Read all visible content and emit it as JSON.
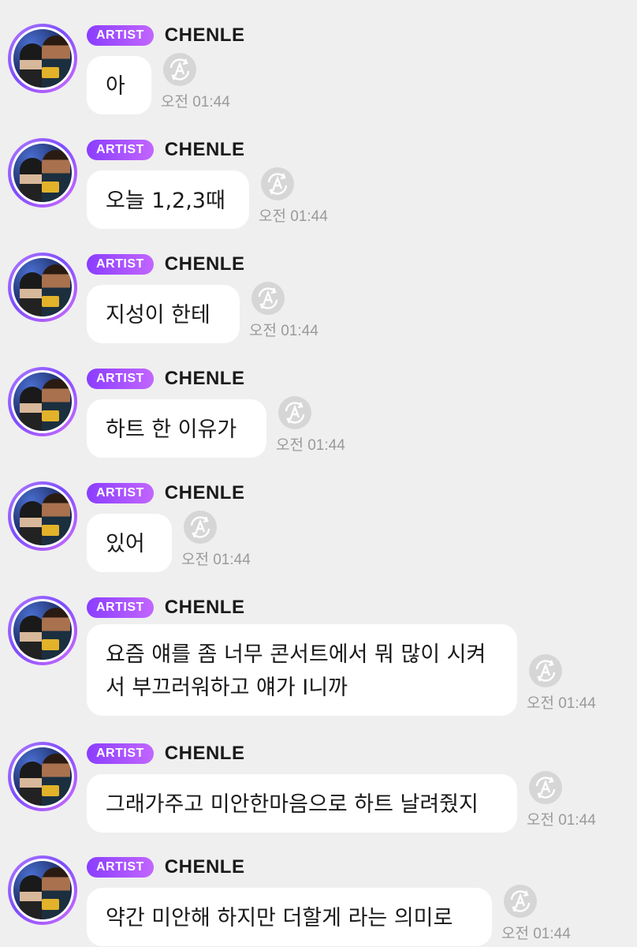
{
  "artist_badge": "ARTIST",
  "artist_name": "CHENLE",
  "messages": [
    {
      "text": "아",
      "time": "오전 01:44"
    },
    {
      "text": "오늘 1,2,3때",
      "time": "오전 01:44"
    },
    {
      "text": "지성이 한테",
      "time": "오전 01:44"
    },
    {
      "text": "하트 한 이유가",
      "time": "오전 01:44"
    },
    {
      "text": "있어",
      "time": "오전 01:44"
    },
    {
      "text": "요즘 얘를 좀 너무 콘서트에서 뭐 많이 시켜서 부끄러워하고 얘가 I니까",
      "time": "오전 01:44"
    },
    {
      "text": "그래가주고 미안한마음으로 하트 날려줬지",
      "time": "오전 01:44"
    },
    {
      "text": "약간 미안해 하지만 더할게 라는 의미로",
      "time": "오전 01:44"
    }
  ],
  "colors": {
    "background": "#efefef",
    "bubble": "#ffffff",
    "badge_start": "#8a3dff",
    "badge_end": "#c266ff",
    "time": "#9a9a9a"
  },
  "icons": {
    "avatar": "artist-avatar-photo",
    "translate": "translate-icon"
  }
}
